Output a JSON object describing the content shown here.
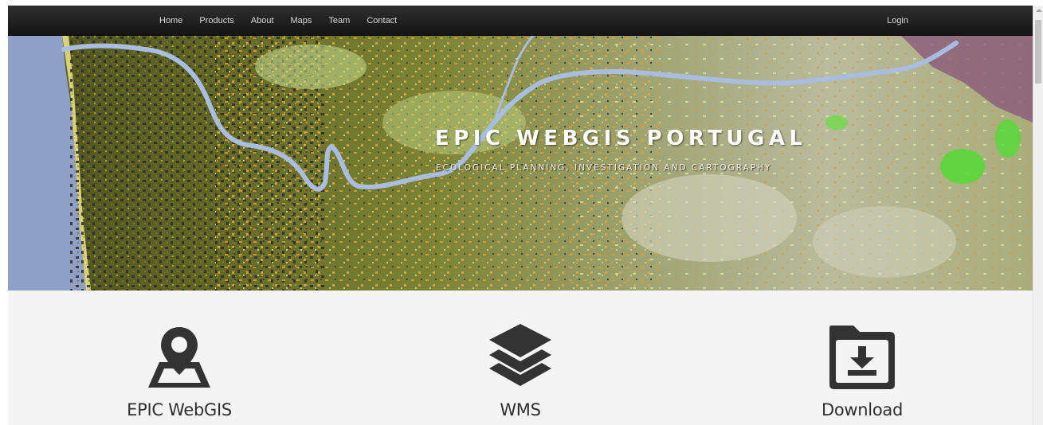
{
  "navbar": {
    "links": [
      "Home",
      "Products",
      "About",
      "Maps",
      "Team",
      "Contact"
    ],
    "login": "Login"
  },
  "hero": {
    "title": "EPIC WEBGIS PORTUGAL",
    "subtitle": "ECOLOGICAL PLANNING, INVESTIGATION AND CARTOGRAPHY"
  },
  "features": [
    {
      "label": "EPIC WebGIS",
      "icon": "map-pin-icon"
    },
    {
      "label": "WMS",
      "icon": "layers-icon"
    },
    {
      "label": "Download",
      "icon": "download-folder-icon"
    }
  ],
  "colors": {
    "navbar": "#1f1f1f",
    "icon": "#333333",
    "features_bg": "#f4f4f4",
    "ocean": "#8fa0c8",
    "river": "#a9bde0"
  }
}
